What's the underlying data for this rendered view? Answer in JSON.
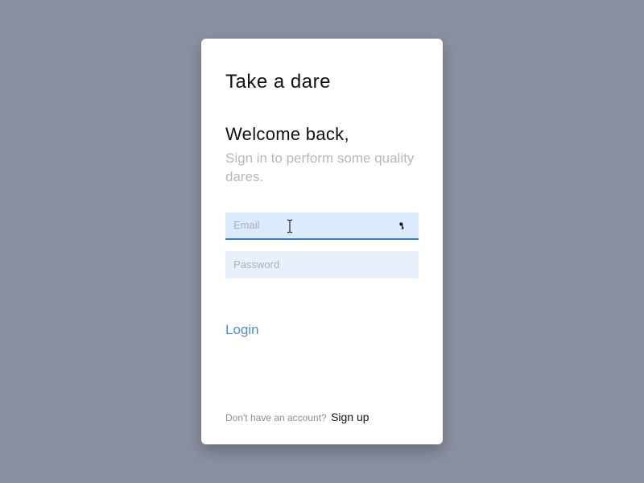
{
  "brand": "Take a dare",
  "welcome": "Welcome back,",
  "subtitle": "Sign in to perform some quality dares.",
  "fields": {
    "email": {
      "placeholder": "Email",
      "value": ""
    },
    "password": {
      "placeholder": "Password",
      "value": ""
    }
  },
  "login_label": "Login",
  "signup_prompt": "Don't have an account?",
  "signup_link": "Sign up"
}
